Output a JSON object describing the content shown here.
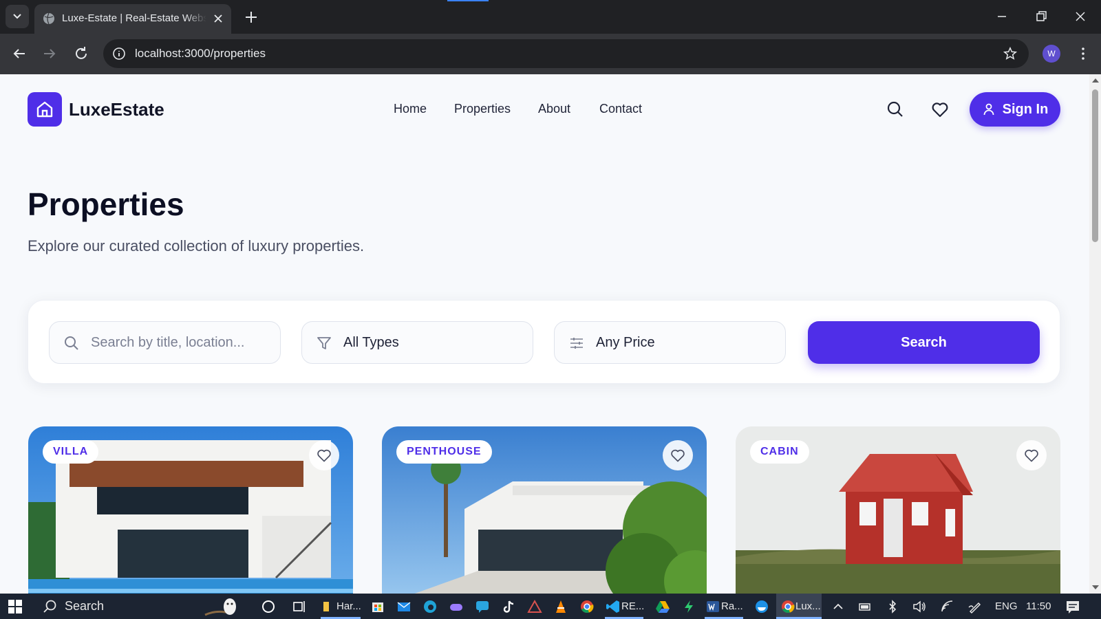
{
  "browser": {
    "tab_title": "Luxe-Estate | Real-Estate Website",
    "url": "localhost:3000/properties",
    "profile_initial": "W"
  },
  "site": {
    "brand": "LuxeEstate",
    "nav": [
      "Home",
      "Properties",
      "About",
      "Contact"
    ],
    "signin_label": "Sign In"
  },
  "page": {
    "title": "Properties",
    "subtitle": "Explore our curated collection of luxury properties."
  },
  "filters": {
    "search_placeholder": "Search by title, location...",
    "type_value": "All Types",
    "price_value": "Any Price",
    "search_button": "Search"
  },
  "properties": [
    {
      "type": "VILLA"
    },
    {
      "type": "PENTHOUSE"
    },
    {
      "type": "CABIN"
    }
  ],
  "taskbar": {
    "search_label": "Search",
    "app_labels": [
      "Har...",
      "RE...",
      "Ra...",
      "Lux..."
    ],
    "language": "ENG",
    "time": "11:50"
  },
  "colors": {
    "accent": "#4f2ee8",
    "background": "#f7f9fc"
  }
}
